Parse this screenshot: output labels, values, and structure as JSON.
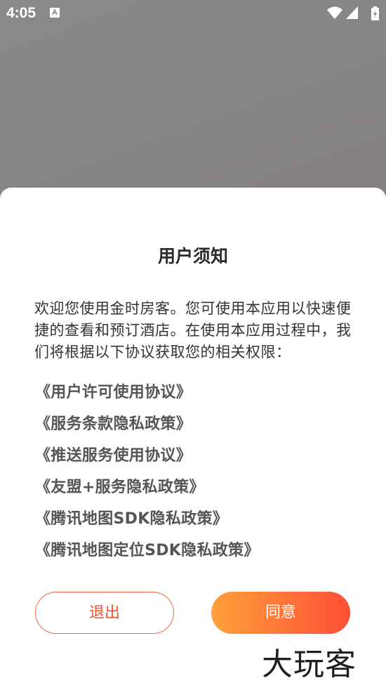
{
  "status_bar": {
    "time": "4:05",
    "notification_icon": "A",
    "icons": [
      "wifi-icon",
      "signal-icon",
      "battery-charging-icon"
    ]
  },
  "dialog": {
    "title": "用户须知",
    "intro": "欢迎您使用金时房客。您可使用本应用以快速便捷的查看和预订酒店。在使用本应用过程中，我们将根据以下协议获取您的相关权限：",
    "links": [
      "《用户许可使用协议》",
      "《服务条款隐私政策》",
      "《推送服务使用协议》",
      "《友盟+服务隐私政策》",
      "《腾讯地图SDK隐私政策》",
      "《腾讯地图定位SDK隐私政策》"
    ],
    "exit_label": "退出",
    "agree_label": "同意"
  },
  "watermark": "大玩客",
  "colors": {
    "accent": "#f0502b",
    "agree_gradient_start": "#ffa03a",
    "agree_gradient_end": "#ff4f36"
  }
}
